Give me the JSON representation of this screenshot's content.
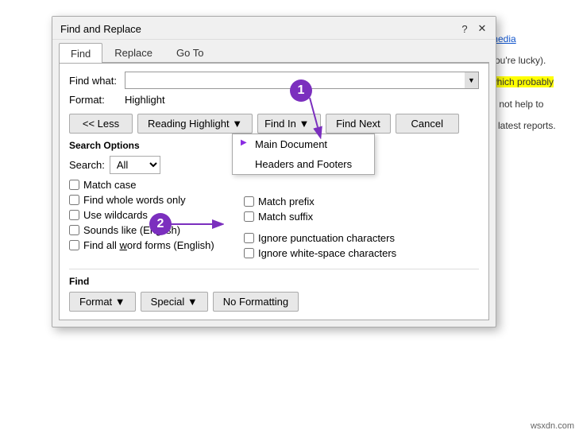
{
  "dialog": {
    "title": "Find and Replace",
    "tabs": [
      {
        "label": "Find",
        "active": true
      },
      {
        "label": "Replace",
        "active": false
      },
      {
        "label": "Go To",
        "active": false
      }
    ],
    "find_what_label": "Find what:",
    "format_label": "Format:",
    "format_value": "Highlight",
    "less_btn": "<< Less",
    "reading_highlight_btn": "Reading Highlight ▼",
    "find_in_btn": "Find In ▼",
    "find_next_btn": "Find Next",
    "cancel_btn": "Cancel",
    "search_options_label": "Search Options",
    "search_label": "Search:",
    "search_value": "All",
    "checkboxes": [
      {
        "label": "Match case",
        "checked": false
      },
      {
        "label": "Find whole words only",
        "checked": false
      },
      {
        "label": "Use wildcards",
        "checked": false
      },
      {
        "label": "Sounds like (English)",
        "checked": false
      },
      {
        "label": "Find all word forms (English)",
        "checked": false,
        "underline_char": "a"
      }
    ],
    "right_checkboxes": [
      {
        "label": "Match prefix",
        "checked": false
      },
      {
        "label": "Match suffix",
        "checked": false
      },
      {
        "label": "Ignore punctuation characters",
        "checked": false
      },
      {
        "label": "Ignore white-space characters",
        "checked": false
      }
    ],
    "find_section_label": "Find",
    "format_btn": "Format ▼",
    "special_btn": "Special ▼",
    "no_formatting_btn": "No Formatting",
    "dropdown_items": [
      {
        "label": "Main Document",
        "active": true
      },
      {
        "label": "Headers and Footers",
        "active": false
      }
    ]
  },
  "doc": {
    "link_text": "media",
    "text1": "you're lucky).",
    "text2": "which probably",
    "text3": "ill not help to",
    "text4": "e latest reports."
  },
  "annotations": {
    "circle1": "1",
    "circle2": "2"
  },
  "credit": "wsxdn.com"
}
